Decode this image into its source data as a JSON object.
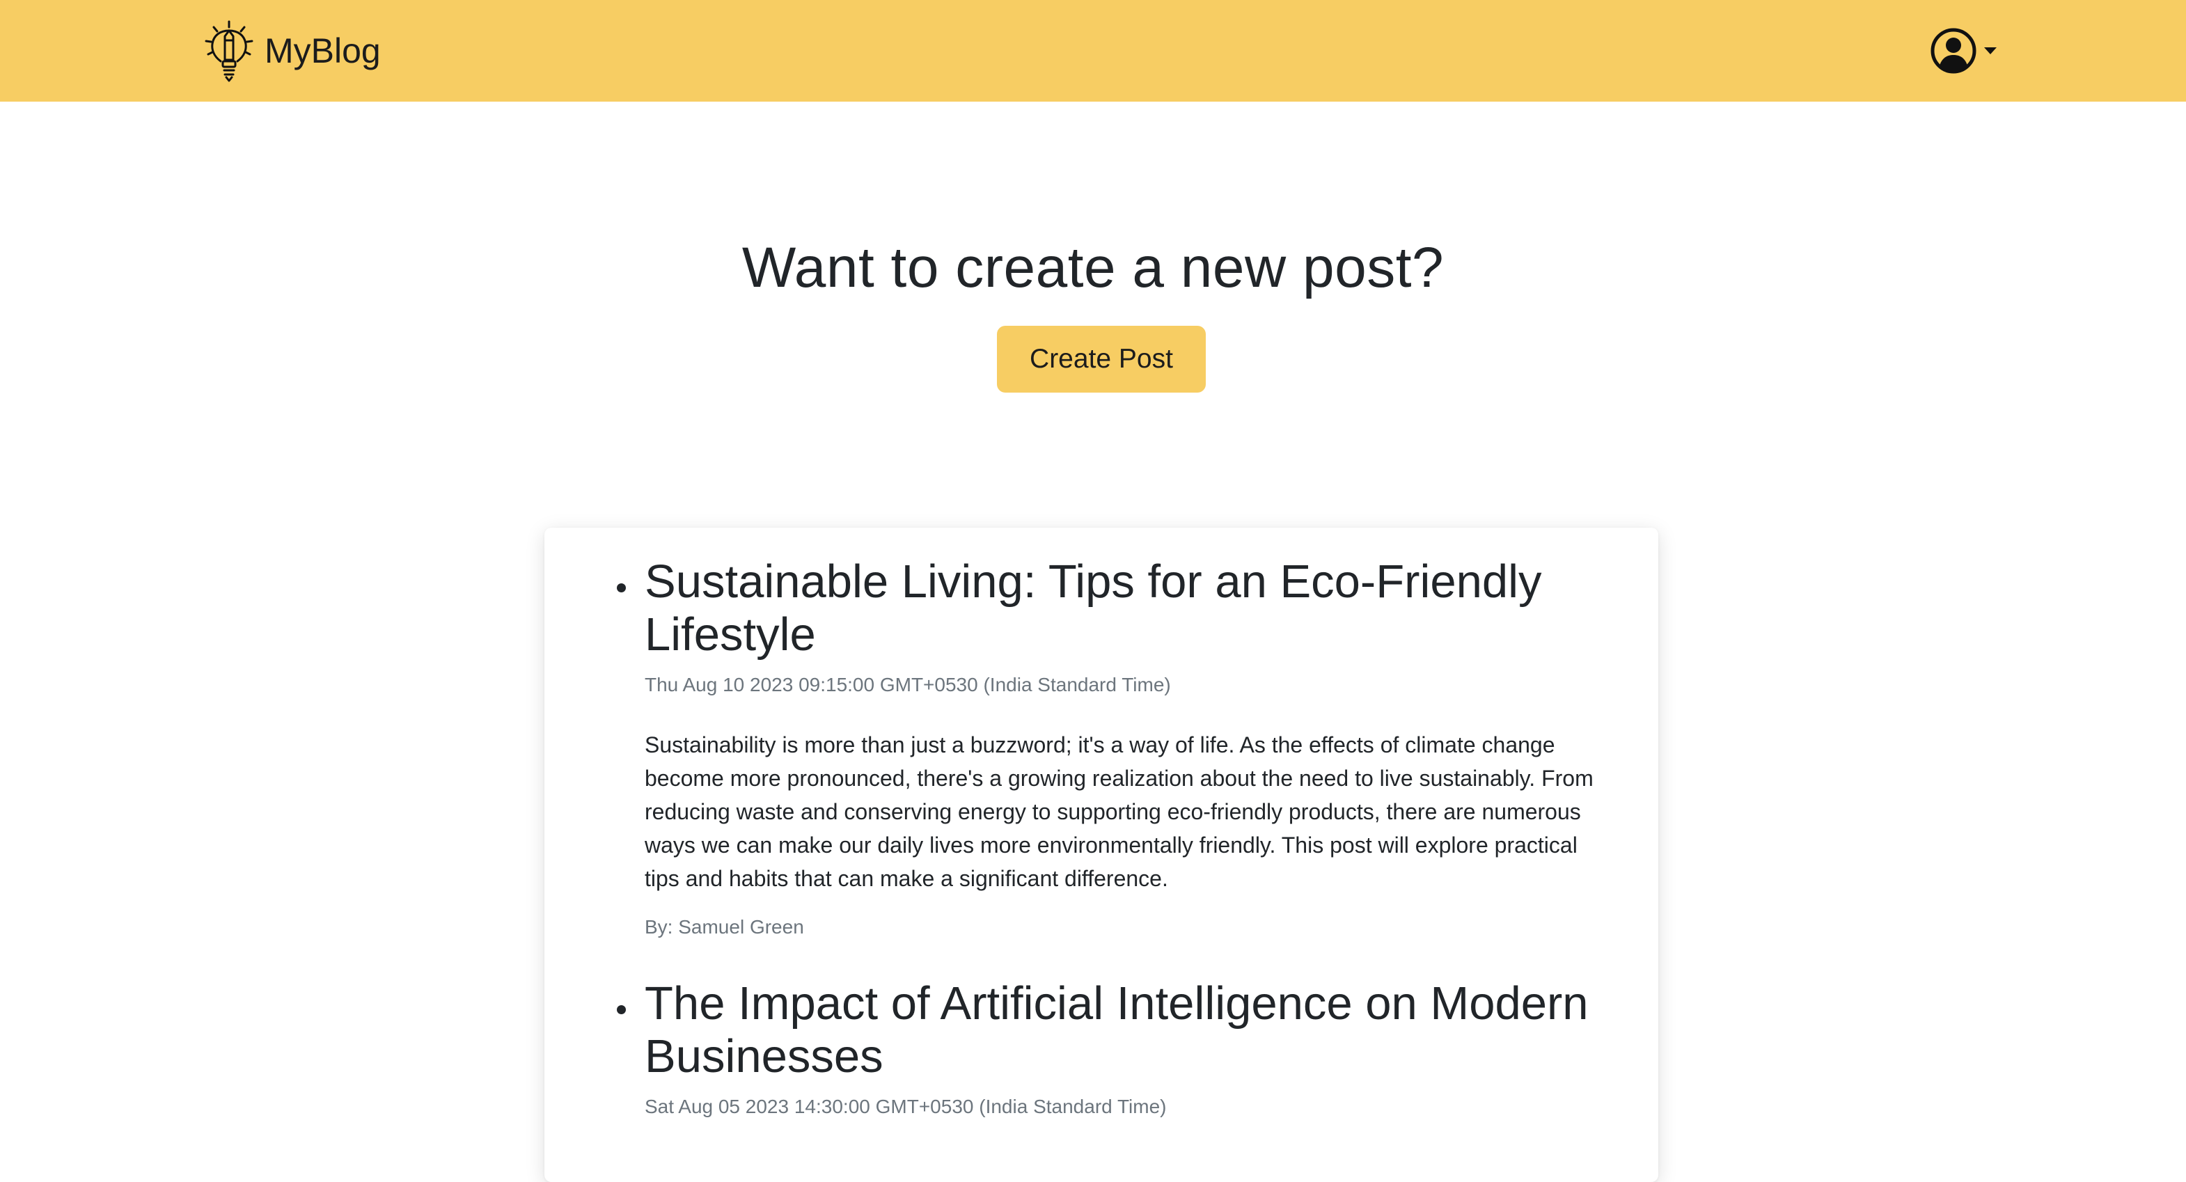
{
  "navbar": {
    "brand_text": "MyBlog",
    "background": "#f7cd63",
    "brand_icon": "lightbulb-pencil-icon",
    "profile_icon": "user-circle-icon",
    "dropdown_icon": "caret-down-icon"
  },
  "hero": {
    "title": "Want to create a new post?",
    "button_label": "Create Post"
  },
  "posts": [
    {
      "title": "Sustainable Living: Tips for an Eco-Friendly Lifestyle",
      "date": "Thu Aug 10 2023 09:15:00 GMT+0530 (India Standard Time)",
      "body": "Sustainability is more than just a buzzword; it's a way of life. As the effects of climate change become more pronounced, there's a growing realization about the need to live sustainably. From reducing waste and conserving energy to supporting eco-friendly products, there are numerous ways we can make our daily lives more environmentally friendly. This post will explore practical tips and habits that can make a significant difference.",
      "author": "By: Samuel Green"
    },
    {
      "title": "The Impact of Artificial Intelligence on Modern Businesses",
      "date": "Sat Aug 05 2023 14:30:00 GMT+0530 (India Standard Time)"
    }
  ]
}
